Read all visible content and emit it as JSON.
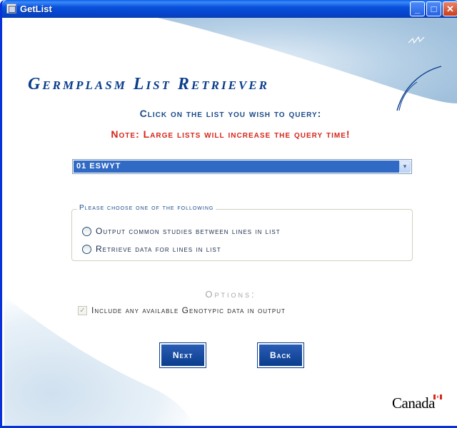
{
  "window": {
    "title": "GetList",
    "controls": {
      "minimize": "_",
      "maximize": "□",
      "close": "✕"
    }
  },
  "banner": {
    "title": "Germplasm List Retriever"
  },
  "prompts": {
    "click": "Click on the list you wish to query:",
    "note": "Note: Large lists will increase the query time!"
  },
  "list_select": {
    "selected": "01 ESWYT",
    "arrow": "▾"
  },
  "query_group": {
    "legend": "Please choose one of the following",
    "options": [
      "Output common studies between lines in list",
      "Retrieve data for lines in list"
    ]
  },
  "options": {
    "title": "Options:",
    "include_genotypic": {
      "label": "Include any available Genotypic data in output",
      "checked": true,
      "enabled": false
    }
  },
  "buttons": {
    "next": "Next",
    "back": "Back"
  },
  "footer": {
    "wordmark": "Canada"
  },
  "colors": {
    "titlebar": "#0850dc",
    "brand_blue": "#0a3d8c",
    "warning_red": "#d6251b",
    "selection": "#316ac5"
  }
}
